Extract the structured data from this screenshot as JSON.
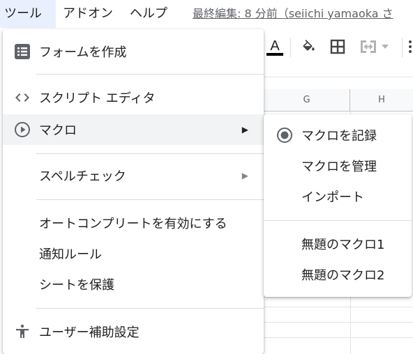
{
  "menubar": {
    "tools": "ツール",
    "addons": "アドオン",
    "help": "ヘルプ",
    "last_edit": "最終編集: 8 分前（seiichi yamaoka さ"
  },
  "columns": {
    "g": "G",
    "h": "H"
  },
  "tools_menu": {
    "create_form": "フォームを作成",
    "script_editor": "スクリプト エディタ",
    "macros": "マクロ",
    "spellcheck": "スペルチェック",
    "autocomplete": "オートコンプリートを有効にする",
    "notification_rules": "通知ルール",
    "protect_sheet": "シートを保護",
    "accessibility": "ユーザー補助設定"
  },
  "macro_submenu": {
    "record": "マクロを記録",
    "manage": "マクロを管理",
    "import": "インポート",
    "macro1": "無題のマクロ1",
    "macro2": "無題のマクロ2"
  },
  "icons": {
    "create_form": "form-list-icon",
    "script_editor": "code-brackets-icon",
    "macros": "play-circle-icon",
    "accessibility": "accessibility-person-icon",
    "record": "record-radio-icon"
  }
}
